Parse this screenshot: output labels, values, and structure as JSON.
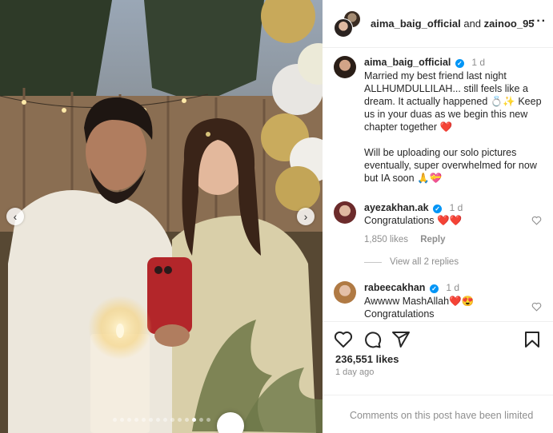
{
  "post": {
    "header": {
      "owner": "aima_baig_official",
      "joiner": "and",
      "collaborator": "zainoo_95",
      "more_icon": "more-horizontal-icon"
    },
    "caption": {
      "username": "aima_baig_official",
      "verified": true,
      "time": "1 d",
      "text": "Married my best friend last night ALLHUMDULLILAH... still feels like a dream. It actually happened 💍✨ Keep us in your duas as we begin this new chapter together ❤️\n\nWill be uploading our solo pictures eventually, super overwhelmed for now but IA soon 🙏💝"
    },
    "comments": [
      {
        "username": "ayezakhan.ak",
        "verified": true,
        "time": "1 d",
        "text": "Congratulations ❤️❤️",
        "likes": "1,850 likes",
        "reply_label": "Reply",
        "view_replies": "View all 2 replies"
      },
      {
        "username": "rabeecakhan",
        "verified": true,
        "time": "1 d",
        "text": "Awwww MashAllah❤️😍\nCongratulations"
      }
    ],
    "likes_count": "236,551 likes",
    "posted_ago": "1 day ago",
    "comments_status": "Comments on this post have been limited",
    "carousel": {
      "total": 14,
      "active_index": 11
    },
    "icons": [
      "heart-icon",
      "comment-icon",
      "share-icon",
      "bookmark-icon",
      "chevron-left-icon",
      "chevron-right-icon"
    ]
  }
}
